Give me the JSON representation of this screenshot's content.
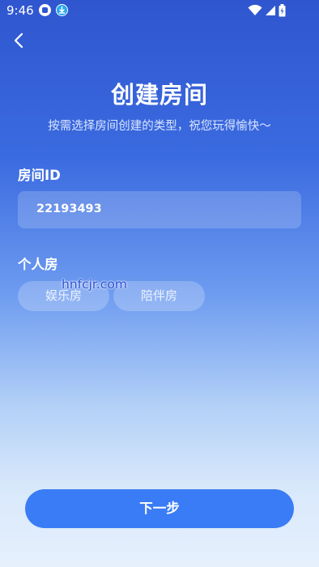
{
  "status_bar": {
    "time": "9:46",
    "icons": [
      "app-badge-icon",
      "download-icon",
      "wifi-icon",
      "signal-icon",
      "battery-icon"
    ]
  },
  "nav": {
    "back_icon": "chevron-left-icon"
  },
  "header": {
    "title": "创建房间",
    "subtitle": "按需选择房间创建的类型，祝您玩得愉快～"
  },
  "room_id": {
    "label": "房间ID",
    "value": "22193493"
  },
  "room_type": {
    "label": "个人房",
    "options": [
      "娱乐房",
      "陪伴房"
    ]
  },
  "watermark": "hnfcjr.com",
  "actions": {
    "next_label": "下一步"
  },
  "colors": {
    "accent": "#3a7cf5",
    "gradient_top": "#2f56cf",
    "gradient_bottom": "#e6f0fd"
  }
}
